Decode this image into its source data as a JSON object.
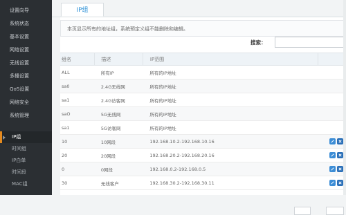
{
  "sidebar": {
    "items": [
      {
        "label": "设置向导"
      },
      {
        "label": "系统状态"
      },
      {
        "label": "基本设置"
      },
      {
        "label": "网络设置"
      },
      {
        "label": "无线设置"
      },
      {
        "label": "多播设置"
      },
      {
        "label": "QoS设置"
      },
      {
        "label": "网络安全"
      },
      {
        "label": "系统管理"
      }
    ],
    "sub_items": [
      {
        "label": "IP组"
      },
      {
        "label": "时间组"
      },
      {
        "label": "IP白单"
      },
      {
        "label": "时间段"
      },
      {
        "label": "MAC组"
      }
    ]
  },
  "tab": {
    "label": "IP组"
  },
  "notice": "本页显示所有的地址组，系统预定义组不能删除和编辑。",
  "search": {
    "label": "搜索：",
    "value": ""
  },
  "table": {
    "headers": [
      "组名",
      "描述",
      "IP范围"
    ],
    "rows": [
      {
        "name": "ALL",
        "desc": "所有IP",
        "range": "所有的IP地址",
        "editable": false
      },
      {
        "name": "sa0",
        "desc": "2.4G无线网",
        "range": "所有的IP地址",
        "editable": false
      },
      {
        "name": "sa1",
        "desc": "2.4G访客网",
        "range": "所有的IP地址",
        "editable": false
      },
      {
        "name": "saO",
        "desc": "5G无线网",
        "range": "所有的IP地址",
        "editable": false
      },
      {
        "name": "sa1",
        "desc": "5G访客网",
        "range": "所有的IP地址",
        "editable": false
      },
      {
        "name": "10",
        "desc": "10网段",
        "range": "192.168.10.2-192.168.10.16",
        "editable": true
      },
      {
        "name": "20",
        "desc": "20网段",
        "range": "192.168.20.2-192.168.20.16",
        "editable": true
      },
      {
        "name": "0",
        "desc": "0网段",
        "range": "192.168.0.2-192.168.0.5",
        "editable": true
      },
      {
        "name": "30",
        "desc": "无线客户",
        "range": "192.168.30.2-192.168.30.11",
        "editable": true
      }
    ]
  },
  "colors": {
    "accent": "#2a8fd6",
    "sidebar_bg": "#2b2f33",
    "active_marker": "#e58a1e"
  }
}
